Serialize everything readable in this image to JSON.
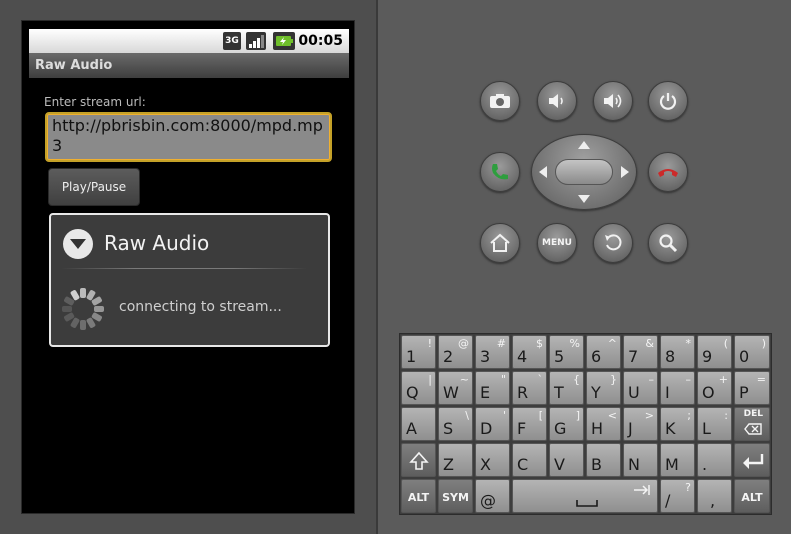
{
  "status_bar": {
    "network": "3G",
    "time": "00:05"
  },
  "app": {
    "title": "Raw Audio",
    "url_label": "Enter stream url:",
    "url_value": "http://pbrisbin.com:8000/mpd.mp3",
    "play_button_label": "Play/Pause"
  },
  "dialog": {
    "title": "Raw Audio",
    "message": "connecting to stream..."
  },
  "hardware": {
    "menu_label": "MENU",
    "call_color": "#2e9e3e",
    "end_call_color": "#cc2a2a"
  },
  "keyboard": {
    "row1": [
      {
        "main": "1",
        "alt": "!"
      },
      {
        "main": "2",
        "alt": "@"
      },
      {
        "main": "3",
        "alt": "#"
      },
      {
        "main": "4",
        "alt": "$"
      },
      {
        "main": "5",
        "alt": "%"
      },
      {
        "main": "6",
        "alt": "^"
      },
      {
        "main": "7",
        "alt": "&"
      },
      {
        "main": "8",
        "alt": "*"
      },
      {
        "main": "9",
        "alt": "("
      },
      {
        "main": "0",
        "alt": ")"
      }
    ],
    "row2": [
      {
        "main": "Q",
        "alt": "|"
      },
      {
        "main": "W",
        "alt": "~"
      },
      {
        "main": "E",
        "alt": "\""
      },
      {
        "main": "R",
        "alt": "`"
      },
      {
        "main": "T",
        "alt": "{"
      },
      {
        "main": "Y",
        "alt": "}"
      },
      {
        "main": "U",
        "alt": "–"
      },
      {
        "main": "I",
        "alt": "–"
      },
      {
        "main": "O",
        "alt": "+"
      },
      {
        "main": "P",
        "alt": "="
      }
    ],
    "row3": [
      {
        "main": "A",
        "alt": ""
      },
      {
        "main": "S",
        "alt": "\\"
      },
      {
        "main": "D",
        "alt": "'"
      },
      {
        "main": "F",
        "alt": "["
      },
      {
        "main": "G",
        "alt": "]"
      },
      {
        "main": "H",
        "alt": "<"
      },
      {
        "main": "J",
        "alt": ">"
      },
      {
        "main": "K",
        "alt": ";"
      },
      {
        "main": "L",
        "alt": ":"
      }
    ],
    "row4": [
      {
        "main": "Z",
        "alt": ""
      },
      {
        "main": "X",
        "alt": ""
      },
      {
        "main": "C",
        "alt": ""
      },
      {
        "main": "V",
        "alt": ""
      },
      {
        "main": "B",
        "alt": ""
      },
      {
        "main": "N",
        "alt": ""
      },
      {
        "main": "M",
        "alt": ""
      },
      {
        "main": ".",
        "alt": ""
      }
    ],
    "del_label": "DEL",
    "alt_label": "ALT",
    "sym_label": "SYM",
    "at_label": "@",
    "slash_main": "/",
    "slash_alt": "?",
    "comma_label": ","
  }
}
